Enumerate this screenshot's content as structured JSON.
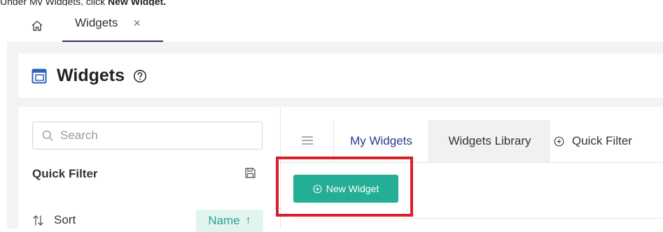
{
  "instruction": {
    "prefix": "Under My Widgets, click ",
    "target": "New Widget."
  },
  "topbar": {
    "home_icon": "home-icon",
    "tab_label": "Widgets",
    "tab_close": "×"
  },
  "header": {
    "icon": "window-icon",
    "title": "Widgets",
    "help_icon": "question-circle-icon"
  },
  "sidebar": {
    "search_placeholder": "Search",
    "quick_filter_title": "Quick Filter",
    "save_icon": "save-icon",
    "sort_label": "Sort",
    "sort_value": "Name",
    "sort_direction": "↑"
  },
  "main": {
    "tabs": [
      {
        "label": "My Widgets",
        "active": true
      },
      {
        "label": "Widgets Library",
        "active": false
      }
    ],
    "quick_filter_label": "Quick Filter",
    "new_widget_label": "New Widget"
  },
  "colors": {
    "accent": "#23ae95",
    "highlight": "#d8202a",
    "active_tab_text": "#2b3a8a"
  }
}
